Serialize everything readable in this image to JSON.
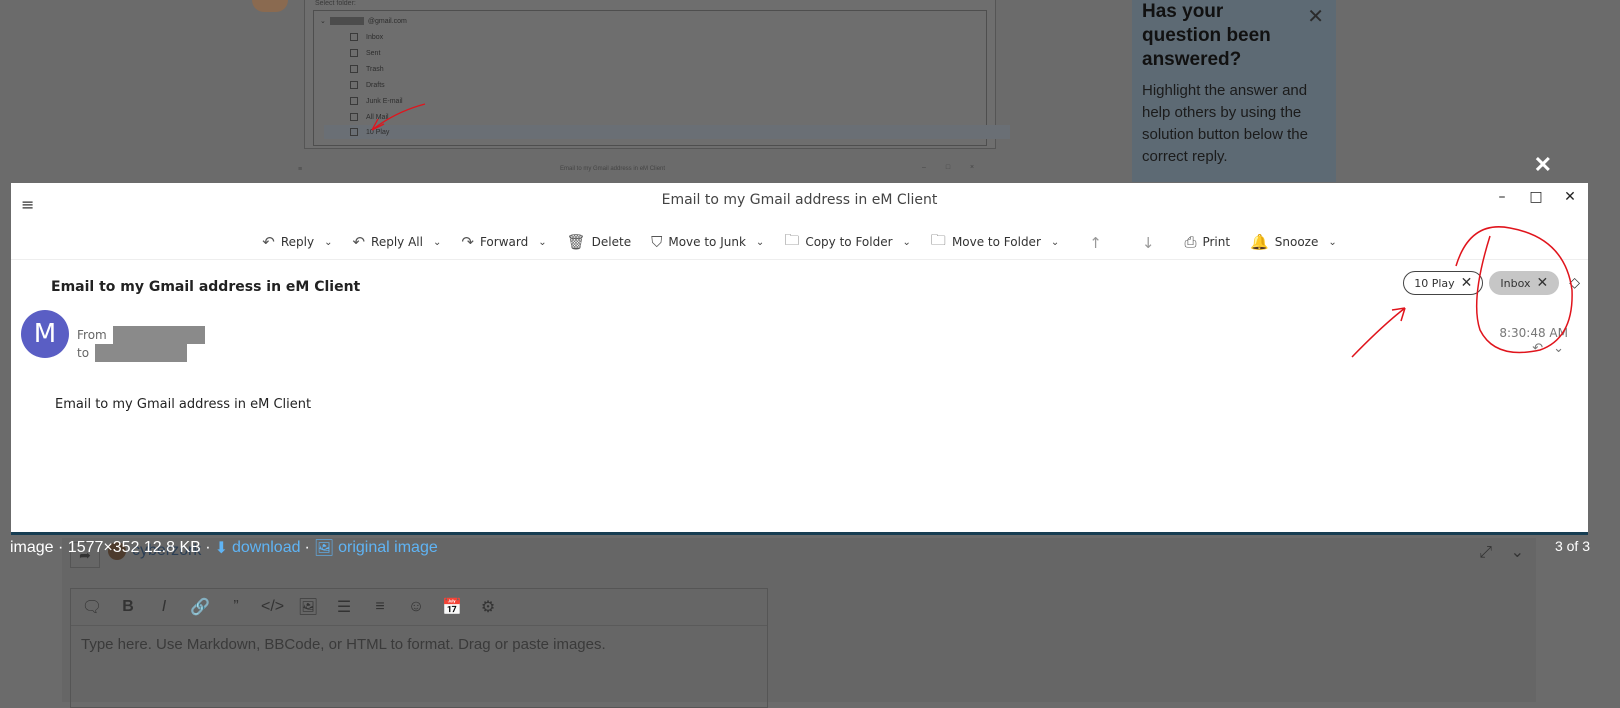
{
  "background": {
    "folder_dialog": {
      "label": "Select folder:",
      "account_suffix": "@gmail.com",
      "folders": [
        "Inbox",
        "Sent",
        "Trash",
        "Drafts",
        "Junk E-mail",
        "All Mail",
        "10 Play"
      ],
      "selected_folder": "10 Play",
      "mini_title": "Email to my Gmail address in eM Client",
      "mini_menu_icon": "≡",
      "mini_controls": "– □ ×"
    },
    "tip": {
      "title": "Has your question been answered?",
      "body": "Highlight the answer and help others by using the solution button below the correct reply.",
      "close": "✕"
    },
    "composer": {
      "username": "cyberzork",
      "placeholder": "Type here. Use Markdown, BBCode, or HTML to format. Drag or paste images.",
      "toolbar_icons": [
        "🗨",
        "B",
        "I",
        "🔗",
        "”",
        "</>",
        "🖼",
        "☰",
        "≡",
        "☺",
        "📅",
        "⚙"
      ]
    }
  },
  "lightbox": {
    "close": "✕",
    "caption_prefix": "image · 1577×352 12.8 KB ·",
    "download_label": "download",
    "separator": "·",
    "original_label": "original image",
    "counter": "3 of 3"
  },
  "email_window": {
    "title": "Email to my Gmail address in eM Client",
    "controls": {
      "minimize": "–",
      "maximize": "□",
      "close": "✕"
    },
    "hamburger": "≡",
    "toolbar": {
      "reply": "Reply",
      "reply_all": "Reply All",
      "forward": "Forward",
      "delete": "Delete",
      "move_to_junk": "Move to Junk",
      "copy_to_folder": "Copy to Folder",
      "move_to_folder": "Move to Folder",
      "print": "Print",
      "snooze": "Snooze",
      "up": "↑",
      "down": "↓"
    },
    "subject": "Email to my Gmail address in eM Client",
    "tags": [
      {
        "label": "10 Play",
        "style": "outline"
      },
      {
        "label": "Inbox",
        "style": "filled"
      }
    ],
    "tag_remove": "✕",
    "tag_add_icon": "◇",
    "sender": {
      "avatar_letter": "M",
      "avatar_color": "#5a5ec4",
      "from_label": "From",
      "to_label": "to"
    },
    "time": "8:30:48 AM",
    "body": "Email to my Gmail address in eM Client"
  },
  "colors": {
    "annotation": "#e0141c",
    "link": "#5fb4f5",
    "overlay": "#6b6b6b"
  }
}
